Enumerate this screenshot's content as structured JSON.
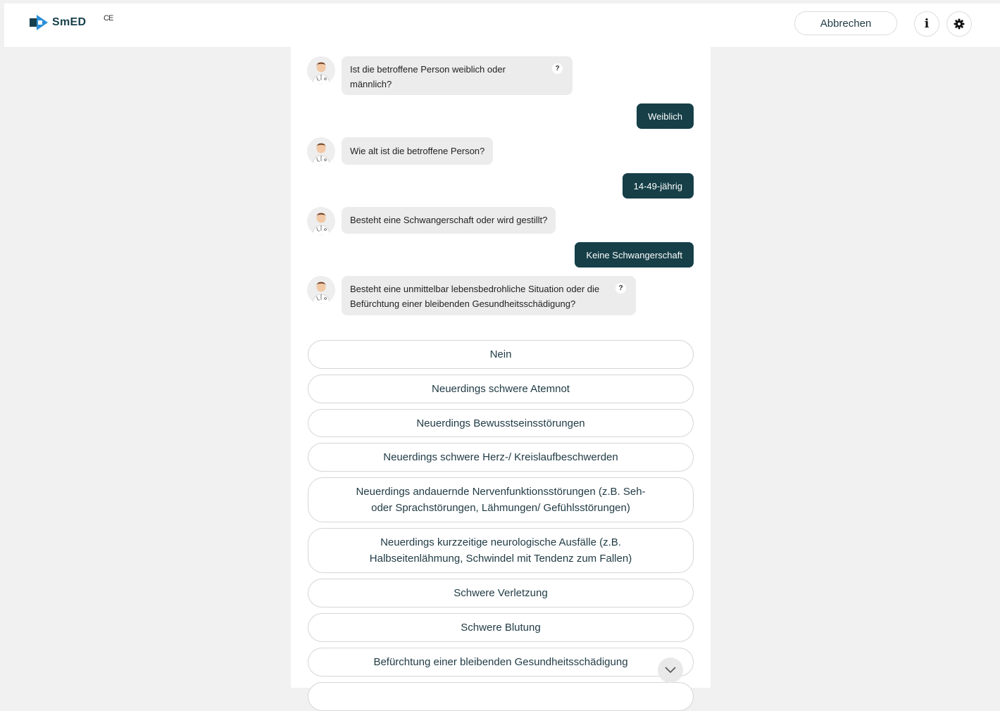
{
  "header": {
    "brand": "SmED",
    "ce_mark": "CE",
    "cancel_label": "Abbrechen",
    "info_label": "i",
    "settings_icon": "gear-icon",
    "brand_color": "#2b8fd8"
  },
  "chat": {
    "help_label": "?",
    "messages": [
      {
        "from": "bot",
        "text": "Ist die betroffene Person weiblich oder männlich?",
        "help": true
      },
      {
        "from": "user",
        "text": "Weiblich"
      },
      {
        "from": "bot",
        "text": "Wie alt ist die betroffene Person?",
        "help": false
      },
      {
        "from": "user",
        "text": "14-49-jährig"
      },
      {
        "from": "bot",
        "text": "Besteht eine Schwangerschaft oder wird gestillt?",
        "help": false
      },
      {
        "from": "user",
        "text": "Keine Schwangerschaft"
      },
      {
        "from": "bot",
        "text": "Besteht eine unmittelbar lebensbedrohliche Situation oder die Befürchtung einer bleibenden Gesundheitsschädigung?",
        "help": true
      }
    ],
    "options": [
      "Nein",
      "Neuerdings schwere Atemnot",
      "Neuerdings Bewusstseinsstörungen",
      "Neuerdings schwere Herz-/ Kreislaufbeschwerden",
      "Neuerdings andauernde Nervenfunktionsstörungen (z.B. Seh- oder Sprachstörungen, Lähmungen/ Gefühlsstörungen)",
      "Neuerdings kurzzeitige neurologische Ausfälle (z.B. Halbseitenlähmung, Schwindel mit Tendenz zum Fallen)",
      "Schwere Verletzung",
      "Schwere Blutung",
      "Befürchtung einer bleibenden Gesundheitsschädigung"
    ],
    "accent_color": "#163f48"
  }
}
